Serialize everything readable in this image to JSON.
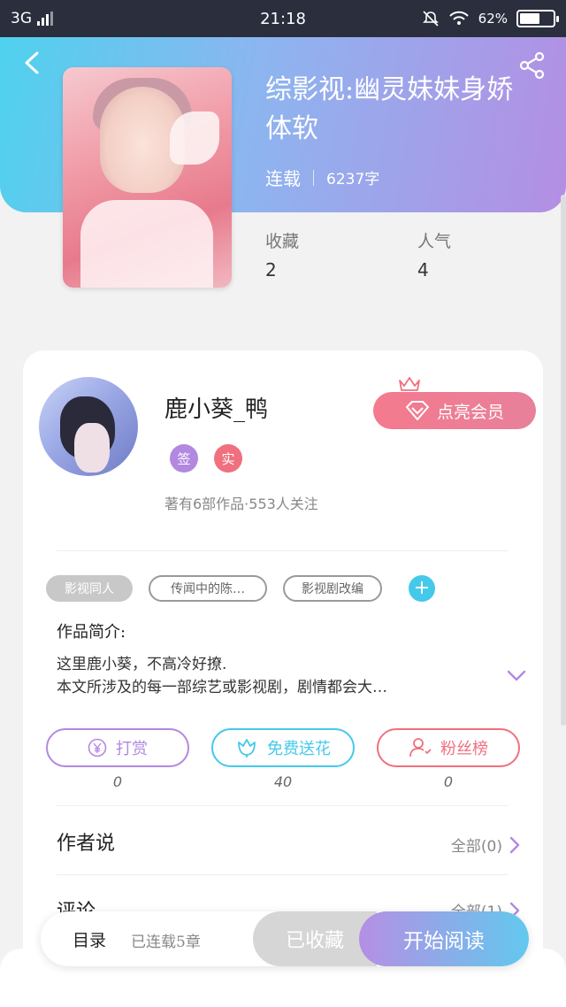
{
  "status_bar": {
    "network": "3G",
    "time": "21:18",
    "battery_percent": "62%",
    "battery_level": 0.62
  },
  "header": {
    "book_title": "综影视:幽灵妹妹身娇体软",
    "status": "连载",
    "word_count": "6237字",
    "stats": [
      {
        "label": "收藏",
        "value": "2"
      },
      {
        "label": "人气",
        "value": "4"
      }
    ],
    "colors": {
      "gradient_start": "#4fd2ee",
      "gradient_end": "#b48ee3"
    }
  },
  "author": {
    "name": "鹿小葵_鸭",
    "vip_button": "点亮会员",
    "badges": [
      {
        "text": "签",
        "color": "#b388e0"
      },
      {
        "text": "实",
        "color": "#f0707f"
      }
    ],
    "stats_text": "著有6部作品·553人关注"
  },
  "tags": [
    "影视同人",
    "传闻中的陈…",
    "影视剧改编"
  ],
  "tag_add": "+",
  "intro": {
    "label": "作品简介:",
    "line1": "这里鹿小葵，不高冷好撩.",
    "line2": "本文所涉及的每一部综艺或影视剧，剧情都会大…"
  },
  "actions": [
    {
      "label": "打赏",
      "count": "0",
      "color": "#b388e0",
      "icon": "yen-coin-icon"
    },
    {
      "label": "免费送花",
      "count": "40",
      "color": "#45c9ea",
      "icon": "flower-icon"
    },
    {
      "label": "粉丝榜",
      "count": "0",
      "color": "#f0707f",
      "icon": "fan-user-icon"
    }
  ],
  "sections": [
    {
      "title": "作者说",
      "more": "全部(0)"
    },
    {
      "title": "评论",
      "more": "全部(1)"
    }
  ],
  "bottom_bar": {
    "toc": "目录",
    "chapters": "已连载5章",
    "collected": "已收藏",
    "read": "开始阅读"
  },
  "icons": [
    "back-arrow-icon",
    "share-icon",
    "crown-icon",
    "diamond-icon",
    "chevron-down-icon",
    "chevron-right-icon"
  ]
}
